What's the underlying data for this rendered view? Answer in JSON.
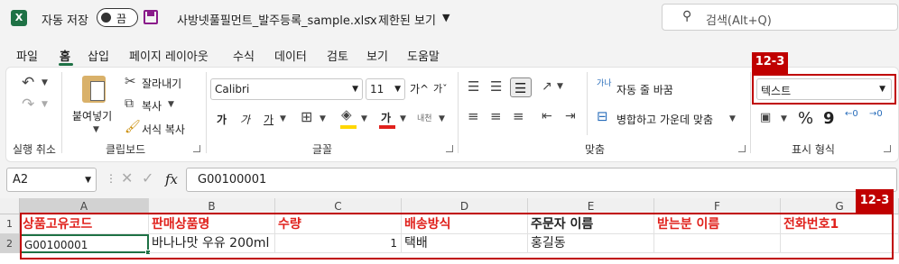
{
  "titlebar": {
    "autosave_label": "자동 저장",
    "toggle_state": "끔",
    "file_name": "사방넷풀필먼트_발주등록_sample.xlsx",
    "separator": "-",
    "view_mode": "제한된 보기",
    "search_placeholder": "검색(Alt+Q)"
  },
  "menu": [
    "파일",
    "홈",
    "삽입",
    "페이지 레이아웃",
    "수식",
    "데이터",
    "검토",
    "보기",
    "도움말"
  ],
  "ribbon": {
    "undo_group_label": "실행 취소",
    "clipboard": {
      "paste": "붙여넣기",
      "cut": "잘라내기",
      "copy": "복사",
      "format_painter": "서식 복사",
      "label": "클립보드"
    },
    "font": {
      "name": "Calibri",
      "size": "11",
      "grow": "가^",
      "shrink": "가ˇ",
      "bold": "가",
      "italic": "가",
      "underline": "가",
      "color_glyph": "가",
      "phonetic": "내천",
      "label": "글꼴",
      "highlight_color": "#ffd700",
      "font_color": "#e0211c"
    },
    "alignment": {
      "wrap": "자동 줄 바꿈",
      "merge": "병합하고 가운데 맞춤",
      "label": "맞춤",
      "wrap_icon": "가나"
    },
    "number": {
      "format": "텍스트",
      "percent": "%",
      "comma": "9",
      "label": "표시 형식"
    }
  },
  "formula": {
    "name_box": "A2",
    "fx": "fx",
    "value": "G00100001"
  },
  "grid": {
    "columns": [
      "A",
      "B",
      "C",
      "D",
      "E",
      "F",
      "G"
    ],
    "rows": [
      "1",
      "2"
    ],
    "row1": [
      "상품고유코드",
      "판매상품명",
      "수량",
      "배송방식",
      "주문자 이름",
      "받는분 이름",
      "전화번호1"
    ],
    "row2": [
      "G00100001",
      "바나나맛 우유 200ml",
      "1",
      "택배",
      "홍길동",
      "",
      ""
    ]
  },
  "callouts": [
    "12-3",
    "12-3"
  ],
  "colors": {
    "excel_green": "#1e7145",
    "accent_purple": "#8a1a8a",
    "callout_red": "#c00000",
    "header_red": "#e0211c"
  }
}
